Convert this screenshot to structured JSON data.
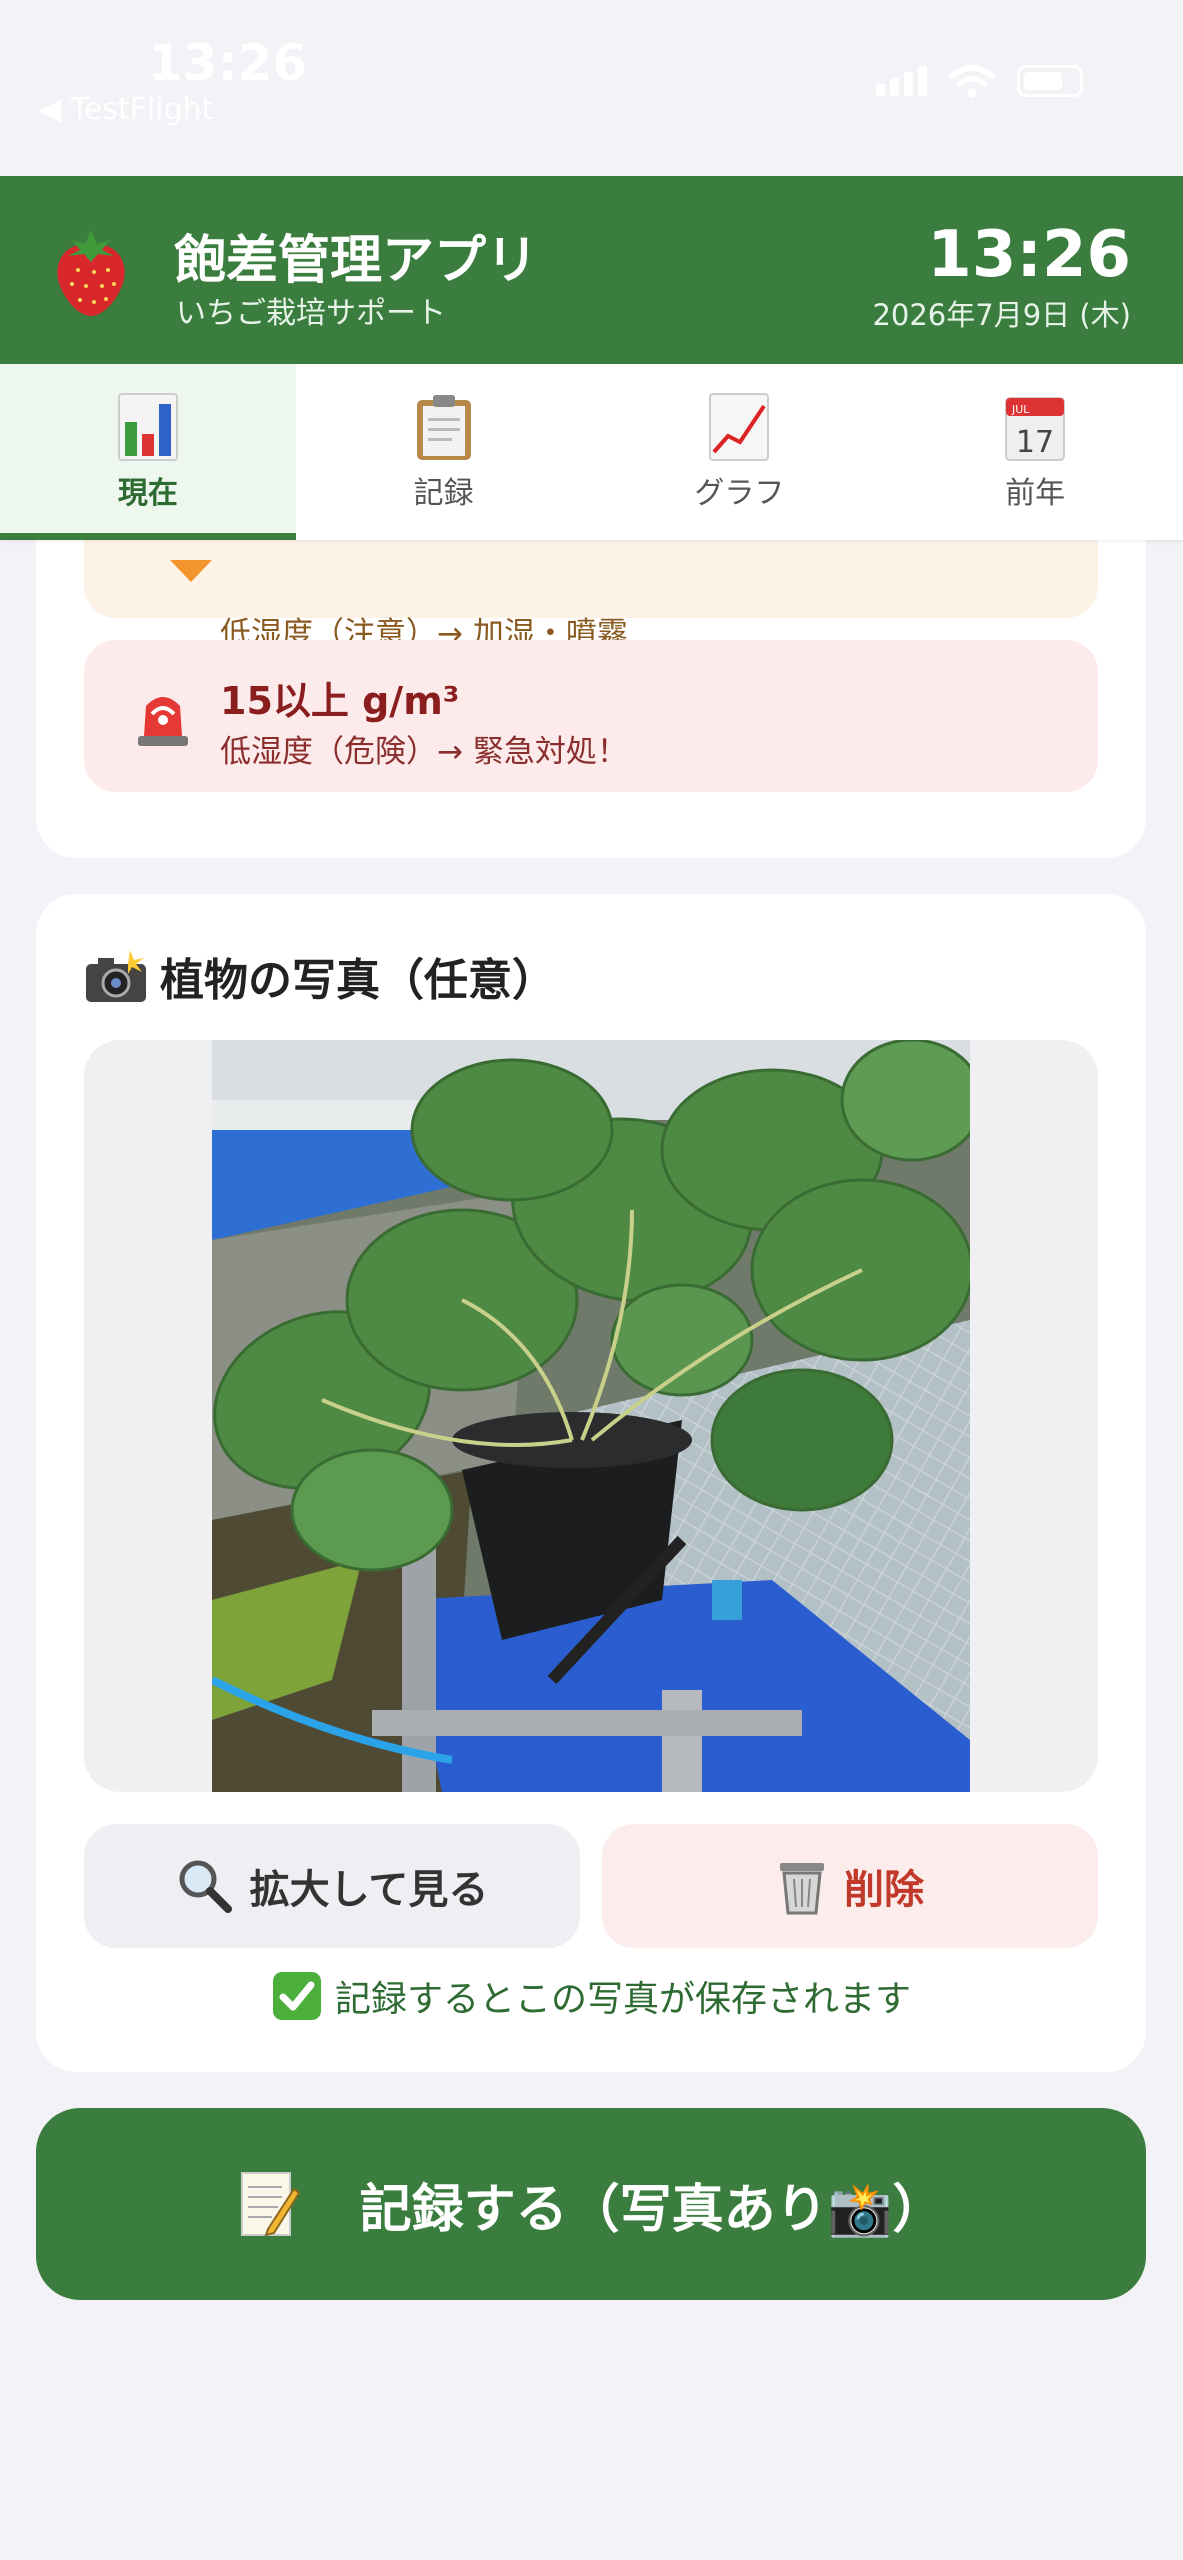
{
  "status_bar": {
    "time": "13:26",
    "back_label": "◀ TestFlight"
  },
  "header": {
    "title": "飽差管理アプリ",
    "subtitle": "いちご栽培サポート",
    "clock": "13:26",
    "date": "2026年7月9日 (木)",
    "logo_icon": "strawberry-icon"
  },
  "tabs": [
    {
      "label": "現在",
      "icon": "bar-chart-icon",
      "active": true
    },
    {
      "label": "記録",
      "icon": "clipboard-icon",
      "active": false
    },
    {
      "label": "グラフ",
      "icon": "line-chart-icon",
      "active": false
    },
    {
      "label": "前年",
      "icon": "calendar-icon",
      "calendar_month": "JUL",
      "calendar_day": "17",
      "active": false
    }
  ],
  "alerts": {
    "warning": {
      "description": "低湿度（注意）→ 加湿・噴霧"
    },
    "danger": {
      "title": "15以上 g/m³",
      "description": "低湿度（危険）→ 緊急対処！"
    }
  },
  "photo_section": {
    "title": "植物の写真（任意）",
    "title_icon": "camera-flash-icon",
    "zoom_button": "拡大して見る",
    "delete_button": "削除",
    "note": "記録するとこの写真が保存されます"
  },
  "record_button": {
    "label": "記録する（写真あり📸）",
    "icon": "memo-icon"
  },
  "colors": {
    "brand_green": "#3a7d3f",
    "danger_red": "#c0392b",
    "background": "#f2f2f7"
  }
}
